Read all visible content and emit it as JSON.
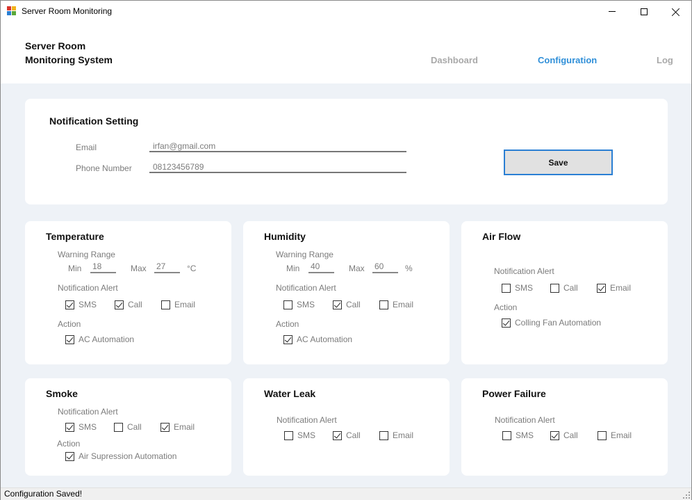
{
  "window": {
    "title": "Server Room Monitoring",
    "icon": "app-window-icon",
    "controls": {
      "minimize": "minimize-icon",
      "maximize": "maximize-icon",
      "close": "close-icon"
    }
  },
  "header": {
    "brand_line1": "Server Room",
    "brand_line2": "Monitoring System",
    "nav": [
      {
        "label": "Dashboard",
        "active": false
      },
      {
        "label": "Configuration",
        "active": true
      },
      {
        "label": "Log",
        "active": false
      }
    ]
  },
  "colors": {
    "accent": "#2f8fd8",
    "background": "#eef2f7",
    "card": "#ffffff",
    "save_border": "#2a7fd4"
  },
  "notification": {
    "title": "Notification Setting",
    "email_label": "Email",
    "email_value": "irfan@gmail.com",
    "phone_label": "Phone Number",
    "phone_value": "08123456789",
    "save_label": "Save"
  },
  "labels": {
    "warning_range": "Warning Range",
    "min": "Min",
    "max": "Max",
    "notification_alert": "Notification Alert",
    "action": "Action",
    "sms": "SMS",
    "call": "Call",
    "email": "Email"
  },
  "temperature": {
    "title": "Temperature",
    "min": "18",
    "max": "27",
    "unit": "°C",
    "sms": true,
    "call": true,
    "email": false,
    "action_label": "AC Automation",
    "action_checked": true
  },
  "humidity": {
    "title": "Humidity",
    "min": "40",
    "max": "60",
    "unit": "%",
    "sms": false,
    "call": true,
    "email": false,
    "action_label": "AC Automation",
    "action_checked": true
  },
  "airflow": {
    "title": "Air Flow",
    "sms": false,
    "call": false,
    "email": true,
    "action_label": "Colling Fan Automation",
    "action_checked": true
  },
  "smoke": {
    "title": "Smoke",
    "sms": true,
    "call": false,
    "email": true,
    "action_label": "Air Supression Automation",
    "action_checked": true
  },
  "waterleak": {
    "title": "Water Leak",
    "sms": false,
    "call": true,
    "email": false
  },
  "powerfailure": {
    "title": "Power Failure",
    "sms": false,
    "call": true,
    "email": false
  },
  "status": {
    "text": "Configuration Saved!"
  }
}
